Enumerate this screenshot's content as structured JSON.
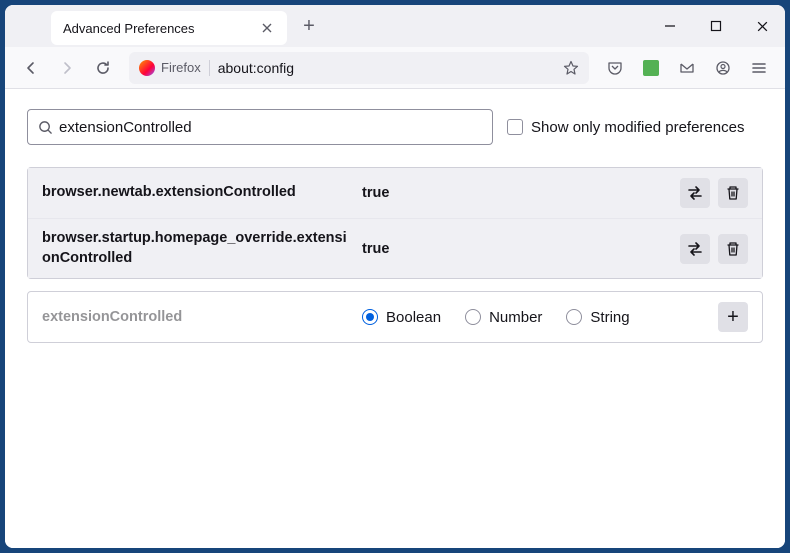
{
  "titlebar": {
    "tab_title": "Advanced Preferences"
  },
  "urlbar": {
    "identity": "Firefox",
    "url": "about:config"
  },
  "search": {
    "value": "extensionControlled",
    "checkbox_label": "Show only modified preferences"
  },
  "prefs": [
    {
      "name": "browser.newtab.extensionControlled",
      "value": "true"
    },
    {
      "name": "browser.startup.homepage_override.extensionControlled",
      "value": "true"
    }
  ],
  "add_row": {
    "label": "extensionControlled",
    "types": [
      "Boolean",
      "Number",
      "String"
    ],
    "selected": "Boolean"
  }
}
